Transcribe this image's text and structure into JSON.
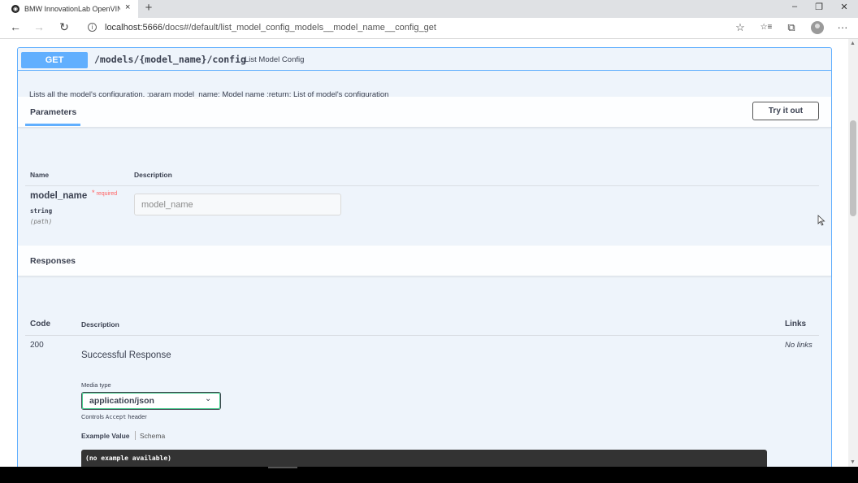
{
  "browser": {
    "tab_title": "BMW InnovationLab OpenVINO",
    "tab_close": "×",
    "new_tab": "+",
    "url_host": "localhost:5666",
    "url_path": "/docs#/default/list_model_config_models__model_name__config_get",
    "window": {
      "minimize": "–",
      "restore": "❐",
      "close": "✕"
    },
    "nav": {
      "back": "←",
      "forward": "→",
      "refresh": "↻"
    },
    "toolbar": {
      "favorite": "☆",
      "favorites": "☆≡",
      "collections": "⧉",
      "more": "···"
    }
  },
  "operation": {
    "method": "GET",
    "path": "/models/{model_name}/config",
    "summary": "List Model Config",
    "description": "Lists all the model's configuration. :param model_name: Model name :return: List of model's configuration"
  },
  "parameters": {
    "title": "Parameters",
    "try_button": "Try it out",
    "col_name": "Name",
    "col_description": "Description",
    "items": [
      {
        "name": "model_name",
        "required_star": "*",
        "required_label": "required",
        "type": "string",
        "in": "(path)",
        "placeholder": "model_name"
      }
    ]
  },
  "responses": {
    "title": "Responses",
    "col_code": "Code",
    "col_description": "Description",
    "col_links": "Links",
    "items": [
      {
        "code": "200",
        "description": "Successful Response",
        "links": "No links",
        "media_type_label": "Media type",
        "media_type_value": "application/json",
        "controls_prefix": "Controls",
        "controls_mono": "Accept",
        "controls_suffix": "header",
        "tab_example": "Example Value",
        "tab_schema": "Schema",
        "example": "(no example available)"
      }
    ]
  },
  "colors": {
    "get_blue": "#61affe",
    "block_bg": "#eef4fb",
    "text": "#3b4151",
    "required_red": "#ff6060",
    "select_green": "#49cc90"
  }
}
